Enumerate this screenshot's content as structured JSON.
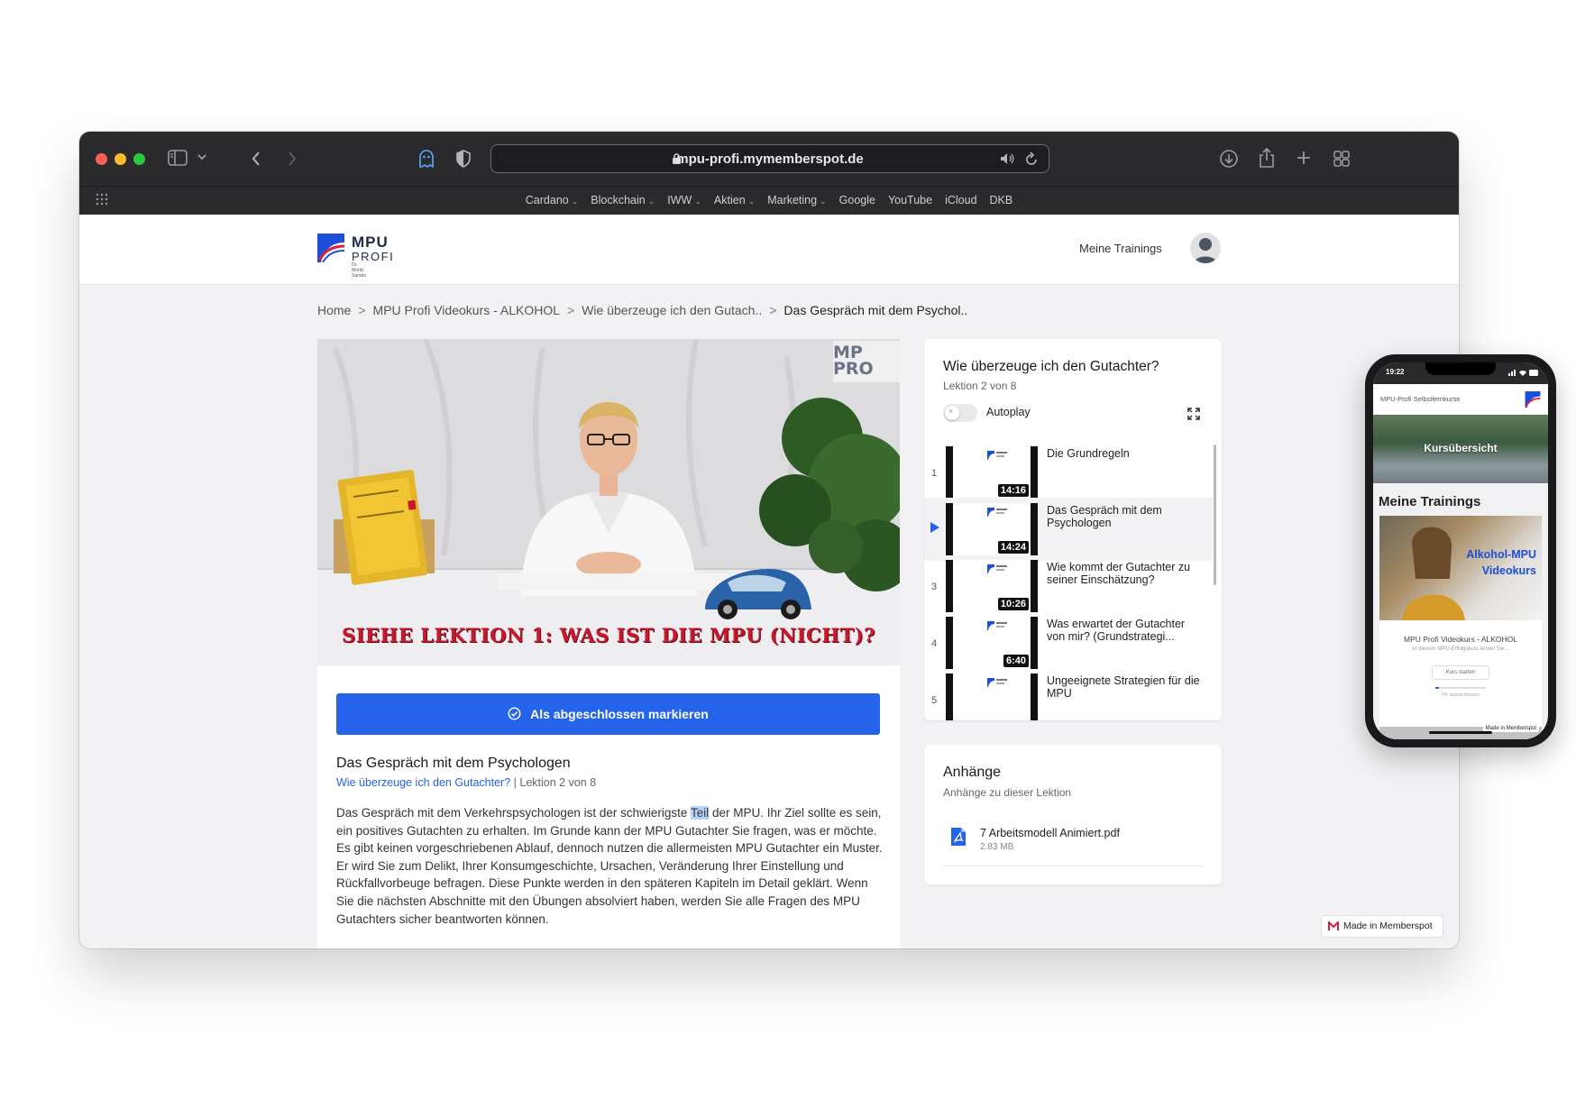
{
  "browser": {
    "url": "mpu-profi.mymemberspot.de",
    "bookmarks": [
      {
        "label": "Cardano",
        "dropdown": true
      },
      {
        "label": "Blockchain",
        "dropdown": true
      },
      {
        "label": "IWW",
        "dropdown": true
      },
      {
        "label": "Aktien",
        "dropdown": true
      },
      {
        "label": "Marketing",
        "dropdown": true
      },
      {
        "label": "Google",
        "dropdown": false
      },
      {
        "label": "YouTube",
        "dropdown": false
      },
      {
        "label": "iCloud",
        "dropdown": false
      },
      {
        "label": "DKB",
        "dropdown": false
      }
    ],
    "colors": {
      "close": "#fe5f57",
      "minimize": "#febc2e",
      "zoom": "#28c840"
    }
  },
  "header": {
    "logo_line1": "MPU",
    "logo_line2": "PROFI",
    "logo_sub": "Dr. Moritz Sander",
    "nav_trainings": "Meine Trainings"
  },
  "breadcrumb": {
    "items": [
      "Home",
      "MPU Profi Videokurs - ALKOHOL",
      "Wie überzeuge ich den Gutach..",
      "Das Gespräch mit dem Psychol.."
    ]
  },
  "video": {
    "caption": "SIEHE LEKTION 1: WAS IST DIE MPU (NICHT)?",
    "watermark": "MP PRO"
  },
  "lesson": {
    "complete_button": "Als abgeschlossen markieren",
    "title": "Das Gespräch mit dem Psychologen",
    "module_link": "Wie überzeuge ich den Gutachter?",
    "position": "Lektion 2 von 8",
    "body_before": "Das Gespräch mit dem Verkehrspsychologen ist der schwierigste ",
    "body_highlight": "Teil",
    "body_after": " der MPU. Ihr Ziel sollte es sein, ein positives Gutachten zu erhalten. Im Grunde kann der MPU Gutachter Sie fragen, was er möchte. Es gibt keinen vorgeschriebenen Ablauf, dennoch nutzen die allermeisten MPU Gutachter ein Muster. Er wird Sie zum Delikt, Ihrer Konsumgeschichte, Ursachen, Veränderung Ihrer Einstellung und Rückfallvorbeuge befragen. Diese Punkte werden in den späteren Kapiteln im Detail geklärt. Wenn Sie die nächsten Abschnitte mit den Übungen absolviert haben, werden Sie alle Fragen des MPU Gutachters sicher beantworten können."
  },
  "sidebar": {
    "title": "Wie überzeuge ich den Gutachter?",
    "subtitle": "Lektion 2 von 8",
    "autoplay_label": "Autoplay",
    "autoplay_on": false,
    "toggle_symbol": "×",
    "lessons": [
      {
        "num": "1",
        "title": "Die Grundregeln",
        "duration": "14:16",
        "active": false
      },
      {
        "num": "",
        "title": "Das Gespräch mit dem Psychologen",
        "duration": "14:24",
        "active": true
      },
      {
        "num": "3",
        "title": "Wie kommt der Gutachter zu seiner Einschätzung?",
        "duration": "10:26",
        "active": false
      },
      {
        "num": "4",
        "title": "Was erwartet der Gutachter von mir? (Grundstrategi...",
        "duration": "6:40",
        "active": false
      },
      {
        "num": "5",
        "title": "Ungeeignete Strategien für die MPU",
        "duration": "",
        "active": false
      }
    ]
  },
  "attachments": {
    "title": "Anhänge",
    "subtitle": "Anhänge zu dieser Lektion",
    "files": [
      {
        "name": "7 Arbeitsmodell Animiert.pdf",
        "size": "2.83 MB"
      }
    ]
  },
  "footer": {
    "made_in": "Made in Memberspot"
  },
  "phone": {
    "time": "19:22",
    "header": "MPU-Profi Selbstlernkurse",
    "banner": "Kursübersicht",
    "heading": "Meine Trainings",
    "card_title_line1": "Alkohol-MPU",
    "card_title_line2": "Videokurs",
    "card_name": "MPU Profi Videokurs - ALKOHOL",
    "card_desc": "In diesem MPU-Erfolgskurs lernen Sie...",
    "card_button": "Kurs starten",
    "card_progress_text": "0% abgeschlossen",
    "made_in": "Made in Memberspot"
  }
}
